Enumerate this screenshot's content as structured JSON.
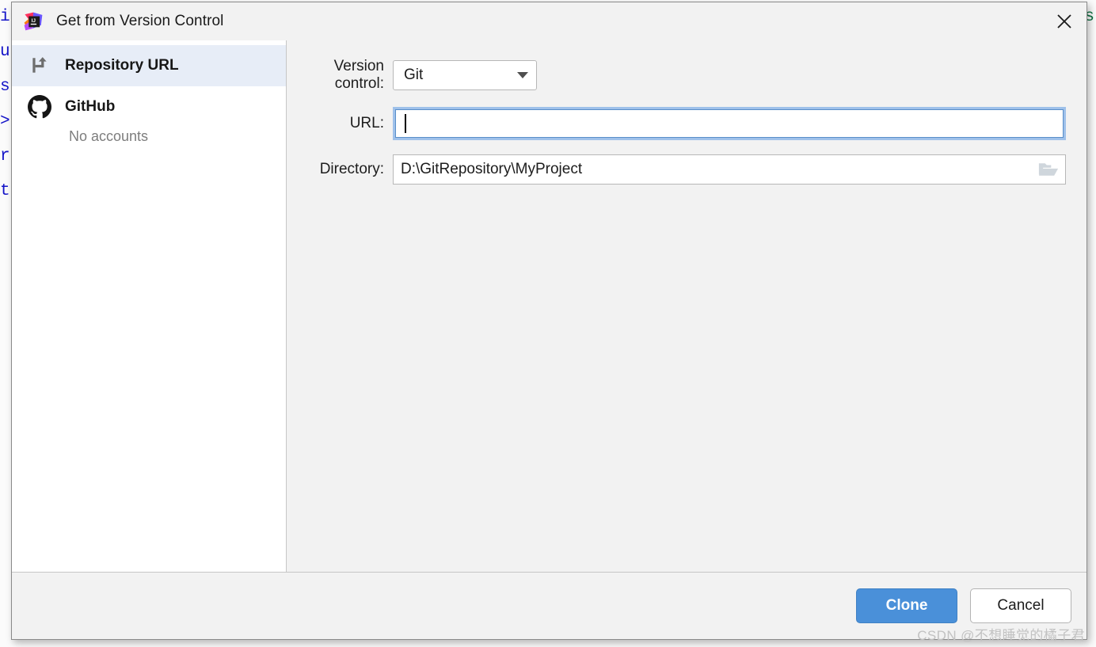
{
  "window": {
    "title": "Get from Version Control",
    "app_icon": "intellij-idea-icon",
    "close_icon": "close-icon"
  },
  "sidebar": {
    "items": [
      {
        "id": "repository-url",
        "label": "Repository URL",
        "icon": "vcs-branch-icon",
        "selected": true,
        "subtitle": ""
      },
      {
        "id": "github",
        "label": "GitHub",
        "icon": "github-icon",
        "selected": false,
        "subtitle": "No accounts"
      }
    ]
  },
  "form": {
    "version_control": {
      "label": "Version control:",
      "value": "Git",
      "options": [
        "Git"
      ],
      "caret_icon": "chevron-down-icon"
    },
    "url": {
      "label": "URL:",
      "value": "",
      "placeholder": "",
      "focused": true
    },
    "directory": {
      "label": "Directory:",
      "value": "D:\\GitRepository\\MyProject",
      "browse_icon": "folder-open-icon"
    }
  },
  "footer": {
    "clone_label": "Clone",
    "cancel_label": "Cancel"
  },
  "watermark": {
    "text": "CSDN @不想睡觉的橘子君"
  },
  "background": {
    "left_column": "i\nu\ns\n>\nr\nt",
    "right_column": "s"
  },
  "colors": {
    "accent": "#4a90d9",
    "selection": "#e7edf7",
    "focus_ring": "#9fc1ea",
    "dialog_bg": "#f2f2f2",
    "sidebar_bg": "#ffffff"
  }
}
